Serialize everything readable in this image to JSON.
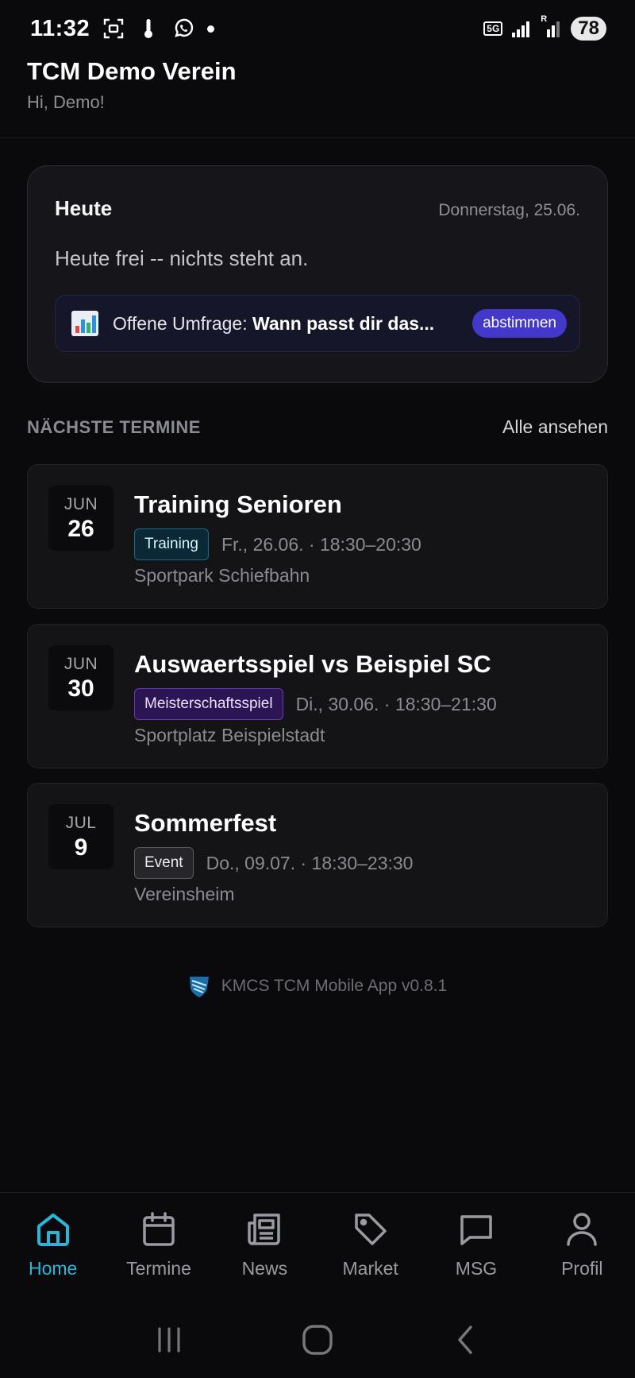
{
  "status_bar": {
    "time": "11:32",
    "network": "5G",
    "roaming": "R",
    "battery": "78"
  },
  "header": {
    "title": "TCM Demo Verein",
    "greeting": "Hi, Demo!"
  },
  "today": {
    "title": "Heute",
    "date": "Donnerstag, 25.06.",
    "message": "Heute frei -- nichts steht an.",
    "poll": {
      "icon": "bar-chart-icon",
      "prefix": "Offene Umfrage: ",
      "question": "Wann passt dir das...",
      "button": "abstimmen"
    }
  },
  "upcoming": {
    "title": "NÄCHSTE TERMINE",
    "link": "Alle ansehen",
    "events": [
      {
        "month": "JUN",
        "day": "26",
        "title": "Training Senioren",
        "tag": "Training",
        "when": "Fr., 26.06. · 18:30–20:30",
        "location": "Sportpark Schiefbahn"
      },
      {
        "month": "JUN",
        "day": "30",
        "title": "Auswaertsspiel vs Beispiel SC",
        "tag": "Meisterschaftsspiel",
        "when": "Di., 30.06. · 18:30–21:30",
        "location": "Sportplatz Beispielstadt"
      },
      {
        "month": "JUL",
        "day": "9",
        "title": "Sommerfest",
        "tag": "Event",
        "when": "Do., 09.07. · 18:30–23:30",
        "location": "Vereinsheim"
      }
    ]
  },
  "footer": {
    "version": "KMCS TCM Mobile App v0.8.1"
  },
  "nav": {
    "items": [
      {
        "label": "Home",
        "icon": "home-icon"
      },
      {
        "label": "Termine",
        "icon": "calendar-icon"
      },
      {
        "label": "News",
        "icon": "newspaper-icon"
      },
      {
        "label": "Market",
        "icon": "tag-icon"
      },
      {
        "label": "MSG",
        "icon": "chat-icon"
      },
      {
        "label": "Profil",
        "icon": "user-icon"
      }
    ]
  },
  "colors": {
    "background": "#0a0a0c",
    "accent": "#29b6d8",
    "poll_button": "#4338ca"
  }
}
